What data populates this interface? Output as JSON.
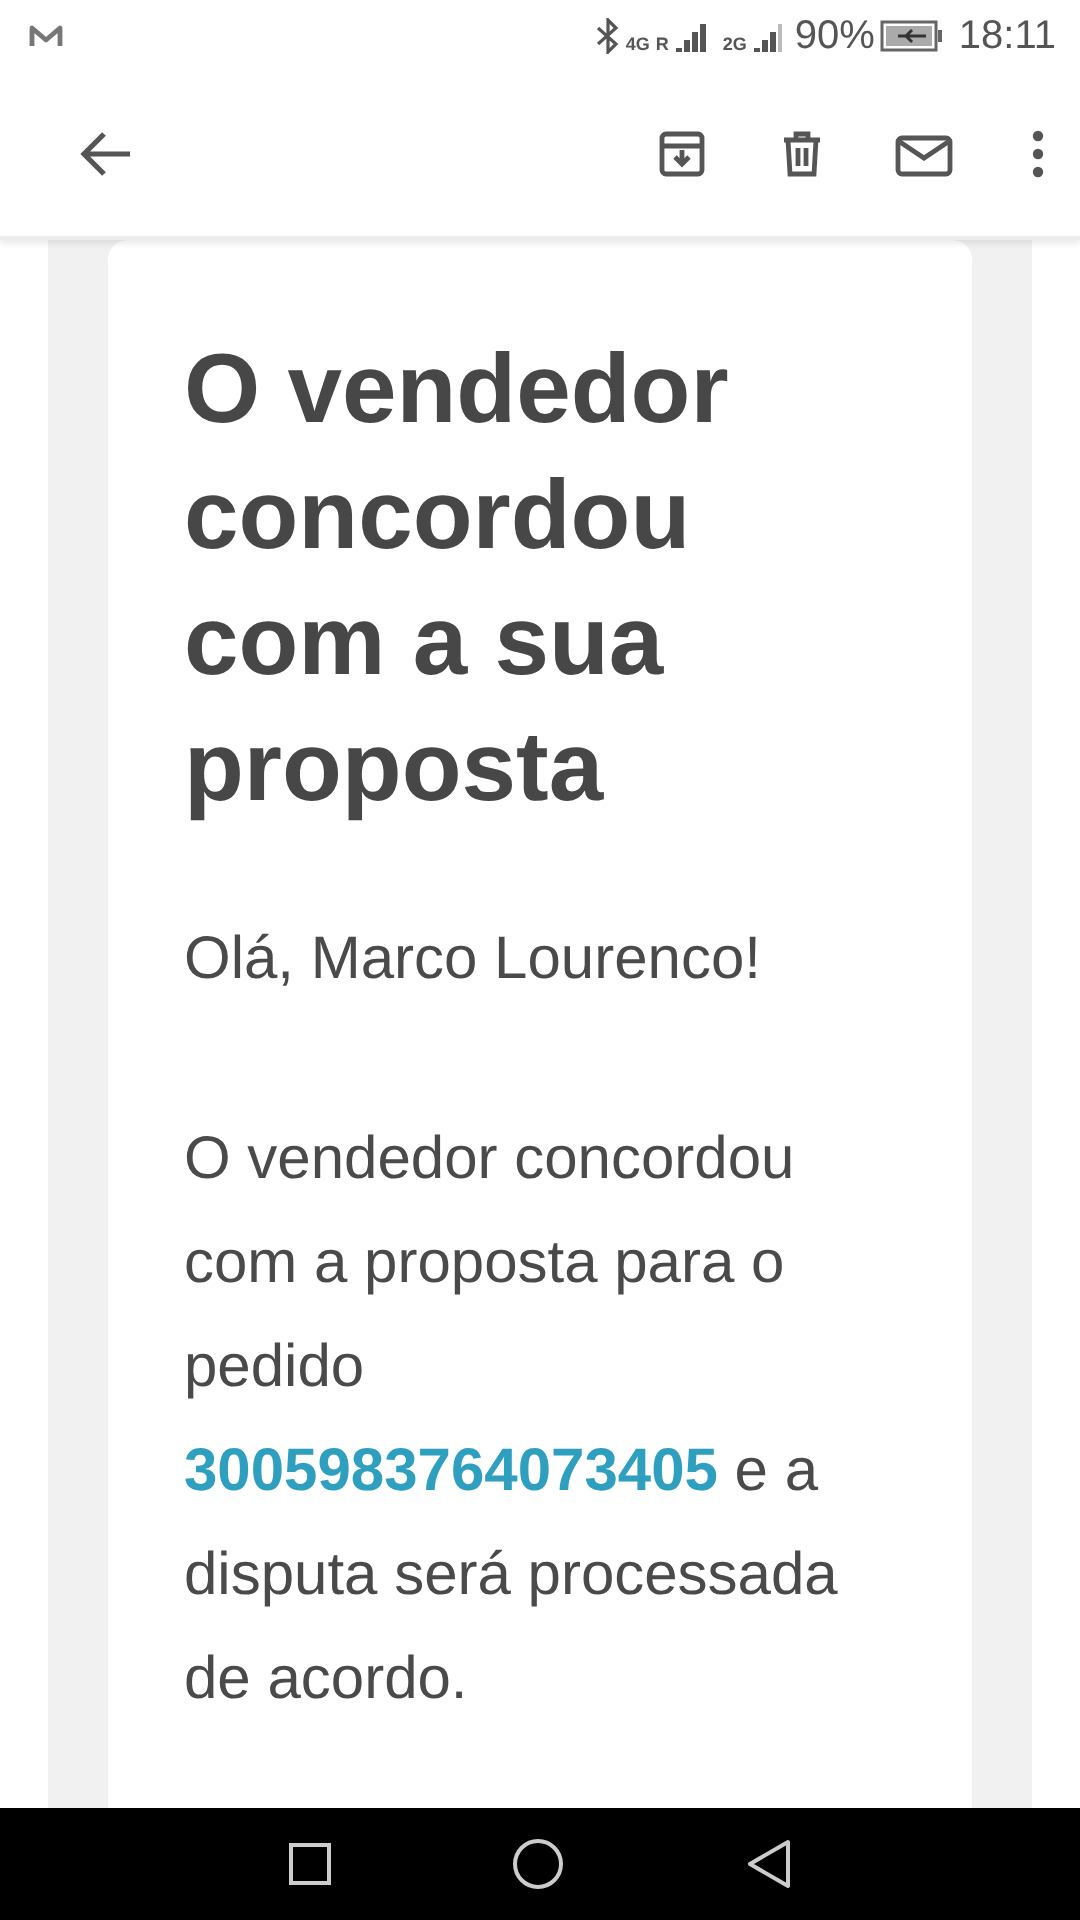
{
  "status_bar": {
    "network_1": "4G",
    "roaming": "R",
    "network_2": "2G",
    "battery": "90%",
    "time": "18:11"
  },
  "toolbar": {
    "actions": [
      {
        "kind": "archive"
      },
      {
        "kind": "delete"
      },
      {
        "kind": "mail"
      },
      {
        "kind": "more"
      }
    ]
  },
  "email": {
    "title": "O vendedor concordou com a sua proposta",
    "greeting": "Olá, Marco Lourenco!",
    "body_before": "O vendedor concordou com a proposta para o pedido",
    "order_link": "3005983764073405",
    "body_after": "e a disputa será processada de acordo."
  }
}
